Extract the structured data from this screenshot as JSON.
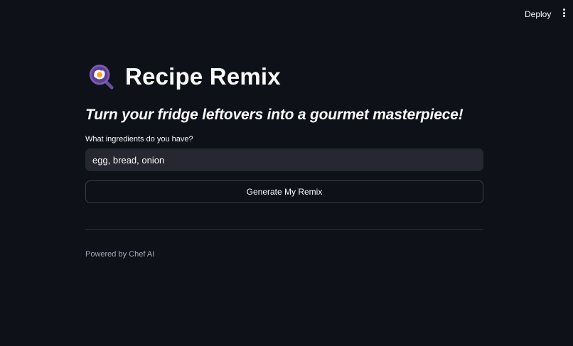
{
  "topbar": {
    "deploy_label": "Deploy",
    "menu_icon": "vertical-dots-icon"
  },
  "header": {
    "icon": "frying-pan-egg-icon",
    "title": "Recipe Remix",
    "subtitle": "Turn your fridge leftovers into a gourmet masterpiece!"
  },
  "form": {
    "ingredients_label": "What ingredients do you have?",
    "ingredients_value": "egg, bread, onion",
    "submit_label": "Generate My Remix"
  },
  "footer": {
    "text": "Powered by Chef AI"
  },
  "colors": {
    "background": "#0e1117",
    "input_background": "#262730",
    "pan": "#7b5bb5",
    "text": "#fafafa"
  }
}
